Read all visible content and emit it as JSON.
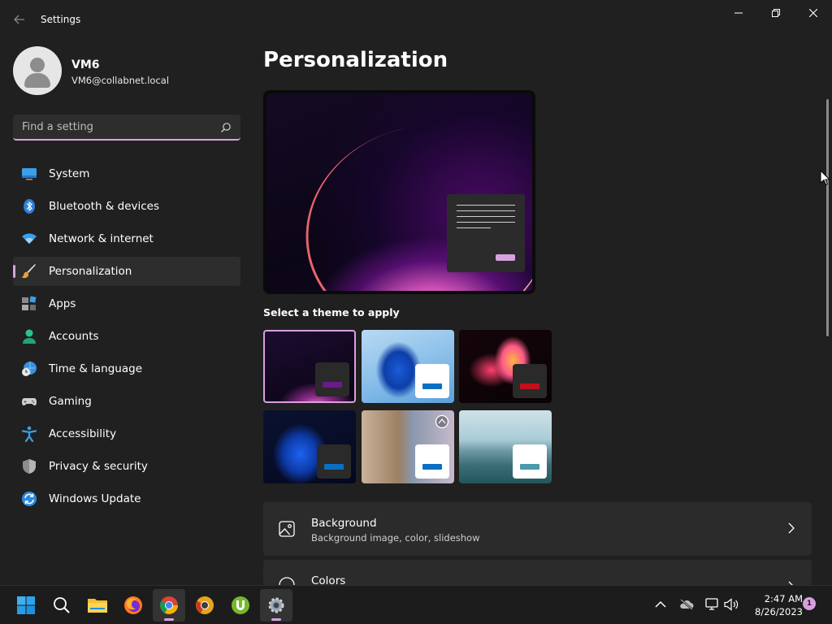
{
  "window": {
    "title": "Settings",
    "controls": [
      "minimize",
      "restore",
      "close"
    ]
  },
  "profile": {
    "name": "VM6",
    "email": "VM6@collabnet.local"
  },
  "search": {
    "placeholder": "Find a setting"
  },
  "sidebar": {
    "items": [
      {
        "label": "System",
        "icon": "monitor-icon"
      },
      {
        "label": "Bluetooth & devices",
        "icon": "bluetooth-icon"
      },
      {
        "label": "Network & internet",
        "icon": "wifi-icon"
      },
      {
        "label": "Personalization",
        "icon": "paintbrush-icon",
        "active": true
      },
      {
        "label": "Apps",
        "icon": "apps-icon"
      },
      {
        "label": "Accounts",
        "icon": "person-icon"
      },
      {
        "label": "Time & language",
        "icon": "globe-clock-icon"
      },
      {
        "label": "Gaming",
        "icon": "gamepad-icon"
      },
      {
        "label": "Accessibility",
        "icon": "accessibility-icon"
      },
      {
        "label": "Privacy & security",
        "icon": "shield-icon"
      },
      {
        "label": "Windows Update",
        "icon": "sync-icon"
      }
    ]
  },
  "main": {
    "title": "Personalization",
    "theme_label": "Select a theme to apply",
    "themes": [
      {
        "selected": true,
        "accent": "#6a1a8a"
      },
      {
        "selected": false,
        "accent": "#0a6fc2"
      },
      {
        "selected": false,
        "accent": "#c0101a"
      },
      {
        "selected": false,
        "accent": "#0a6fc2"
      },
      {
        "selected": false,
        "accent": "#0a6fc2"
      },
      {
        "selected": false,
        "accent": "#4a9aaa"
      }
    ],
    "cards": [
      {
        "title": "Background",
        "subtitle": "Background image, color, slideshow",
        "icon": "image-icon"
      },
      {
        "title": "Colors",
        "subtitle": "",
        "icon": "palette-icon"
      }
    ]
  },
  "taskbar": {
    "apps": [
      "start-icon",
      "search-icon",
      "file-explorer-icon",
      "firefox-icon",
      "chrome-icon",
      "chrome-canary-icon",
      "utorrent-icon",
      "settings-icon"
    ],
    "active_app": "settings-icon",
    "tray": [
      "chevron-up-icon",
      "cloud-offline-icon",
      "network-icon",
      "volume-icon"
    ],
    "time": "2:47 AM",
    "date": "8/26/2023",
    "notification_count": "1"
  },
  "colors": {
    "accent": "#d9a0e0",
    "background": "#202020",
    "card": "#2b2b2b"
  }
}
